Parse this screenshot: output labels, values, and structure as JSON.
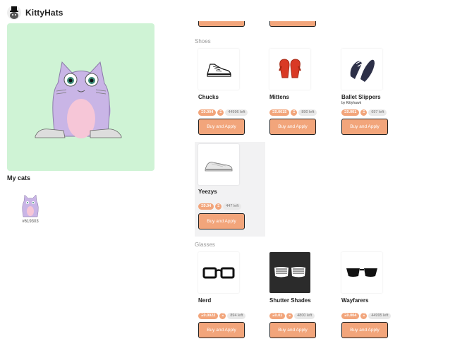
{
  "app": {
    "title": "KittyHats"
  },
  "sidebar": {
    "my_cats_label": "My cats",
    "cats": [
      {
        "id": "#619303"
      }
    ]
  },
  "shop": {
    "sections": [
      {
        "label": "Shoes",
        "items": [
          {
            "name": "Chucks",
            "byline": "",
            "price": "Ξ0.004",
            "currency": "Ξ",
            "stock": "44996 left",
            "button": "Buy and Apply",
            "icon": "sneaker-icon"
          },
          {
            "name": "Mittens",
            "byline": "",
            "price": "Ξ0.0015",
            "currency": "Ξ",
            "stock": "890 left",
            "button": "Buy and Apply",
            "icon": "mittens-icon"
          },
          {
            "name": "Ballet Slippers",
            "byline": "by Kittyhawk",
            "price": "Ξ0.001",
            "currency": "Ξ",
            "stock": "697 left",
            "button": "Buy and Apply",
            "icon": "ballet-slippers-icon"
          },
          {
            "name": "Yeezys",
            "byline": "",
            "price": "Ξ0.04",
            "currency": "Ξ",
            "stock": "447 left",
            "button": "Buy and Apply",
            "icon": "yeezy-icon"
          }
        ]
      },
      {
        "label": "Glasses",
        "items": [
          {
            "name": "Nerd",
            "byline": "",
            "price": "Ξ0.0022",
            "currency": "Ξ",
            "stock": "894 left",
            "button": "Buy and Apply",
            "icon": "nerd-glasses-icon"
          },
          {
            "name": "Shutter Shades",
            "byline": "",
            "price": "Ξ0.01",
            "currency": "Ξ",
            "stock": "4800 left",
            "button": "Buy and Apply",
            "icon": "shutter-shades-icon"
          },
          {
            "name": "Wayfarers",
            "byline": "",
            "price": "Ξ0.004",
            "currency": "Ξ",
            "stock": "44995 left",
            "button": "Buy and Apply",
            "icon": "wayfarers-icon"
          }
        ]
      }
    ]
  },
  "colors": {
    "accent": "#f2a57b",
    "hero_bg": "#cff3d5",
    "cat_body": "#c9b5e6",
    "cat_belly": "#f6c6d7"
  }
}
